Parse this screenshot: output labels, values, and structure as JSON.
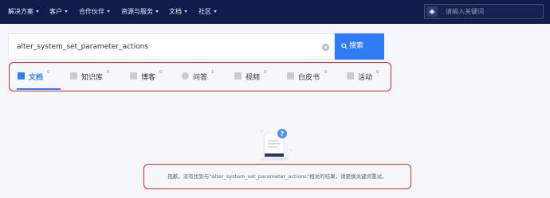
{
  "topnav": {
    "items": [
      {
        "label": "解决方案"
      },
      {
        "label": "客户"
      },
      {
        "label": "合作伙伴"
      },
      {
        "label": "资源与服务"
      },
      {
        "label": "文档"
      },
      {
        "label": "社区"
      }
    ],
    "search_placeholder": "请输入关键词"
  },
  "search": {
    "query": "alter_system_set_parameter_actions",
    "button_label": "搜索"
  },
  "tabs": [
    {
      "label": "文档",
      "count": "0",
      "icon": "document-icon",
      "active": true
    },
    {
      "label": "知识库",
      "count": "0",
      "icon": "knowledge-base-icon"
    },
    {
      "label": "博客",
      "count": "0",
      "icon": "blog-icon"
    },
    {
      "label": "问答",
      "count": "1",
      "icon": "qa-icon"
    },
    {
      "label": "视频",
      "count": "0",
      "icon": "video-icon"
    },
    {
      "label": "白皮书",
      "count": "0",
      "icon": "whitepaper-icon"
    },
    {
      "label": "活动",
      "count": "0",
      "icon": "event-icon"
    }
  ],
  "empty_state": {
    "message": "抱歉，没有找到与“alter_system_set_parameter_actions”相关的结果，请更换关键词重试。"
  },
  "colors": {
    "nav_bg": "#0f1d4a",
    "accent": "#2f7cf6",
    "annotation_red": "#d9262b"
  }
}
